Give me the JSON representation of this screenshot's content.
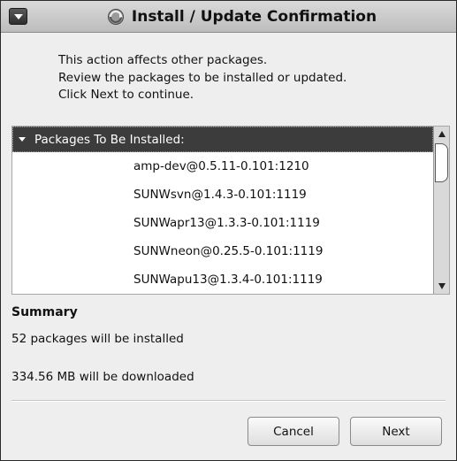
{
  "window": {
    "title": "Install / Update Confirmation",
    "title_icon": "package-manager-icon",
    "menu_icon": "window-menu-icon"
  },
  "intro": {
    "lines": [
      "This action affects other packages.",
      "Review the packages to be installed or updated.",
      "Click Next to continue."
    ]
  },
  "package_list": {
    "group_label": "Packages To Be Installed:",
    "items": [
      "amp-dev@0.5.11-0.101:1210",
      "SUNWsvn@1.4.3-0.101:1119",
      "SUNWapr13@1.3.3-0.101:1119",
      "SUNWneon@0.25.5-0.101:1119",
      "SUNWapu13@1.3.4-0.101:1119"
    ]
  },
  "summary": {
    "title": "Summary",
    "install_count_text": "52 packages will be installed",
    "download_size_text": "334.56 MB will be downloaded"
  },
  "buttons": {
    "cancel_label": "Cancel",
    "next_label": "Next"
  },
  "colors": {
    "group_header_bg": "#3c3c3c",
    "window_bg": "#eeeeee"
  }
}
